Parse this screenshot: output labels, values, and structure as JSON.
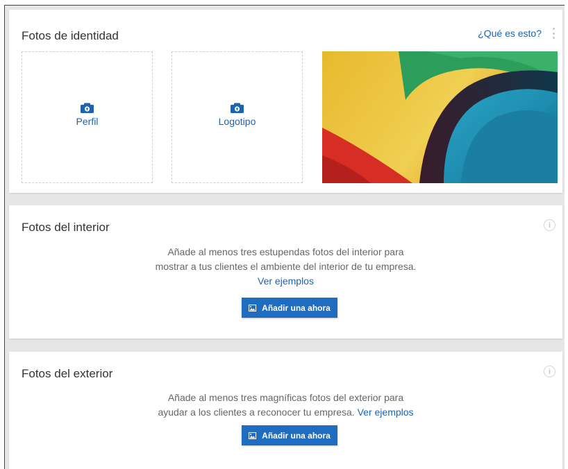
{
  "identity": {
    "title": "Fotos de identidad",
    "help_link": "¿Qué es esto?",
    "profile_label": "Perfil",
    "logo_label": "Logotipo"
  },
  "interior": {
    "title": "Fotos del interior",
    "line1": "Añade al menos tres estupendas fotos del interior para",
    "line2": "mostrar a tus clientes el ambiente del interior de tu empresa.",
    "examples_link": "Ver ejemplos",
    "button_label": "Añadir una ahora"
  },
  "exterior": {
    "title": "Fotos del exterior",
    "line1": "Añade al menos tres magníficas fotos del exterior para",
    "line2": "ayudar a los clientes a reconocer tu empresa.",
    "examples_link": "Ver ejemplos",
    "button_label": "Añadir una ahora"
  },
  "colors": {
    "link": "#1a63b3",
    "button": "#1e6dc1",
    "background": "#e6e6e6"
  },
  "icons": [
    "camera-upload-icon",
    "more-vert-icon",
    "info-icon",
    "photo-icon"
  ]
}
